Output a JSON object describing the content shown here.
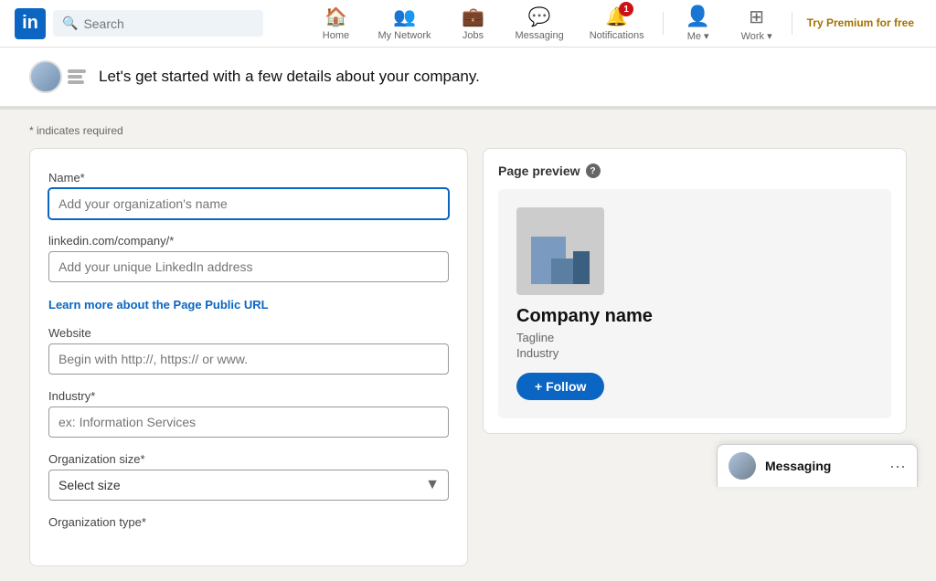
{
  "navbar": {
    "logo": "in",
    "search_placeholder": "Search",
    "nav_items": [
      {
        "id": "home",
        "label": "Home",
        "icon": "🏠",
        "badge": null
      },
      {
        "id": "my-network",
        "label": "My Network",
        "icon": "👥",
        "badge": null
      },
      {
        "id": "jobs",
        "label": "Jobs",
        "icon": "💼",
        "badge": null
      },
      {
        "id": "messaging",
        "label": "Messaging",
        "icon": "💬",
        "badge": null
      },
      {
        "id": "notifications",
        "label": "Notifications",
        "icon": "🔔",
        "badge": "1"
      },
      {
        "id": "me",
        "label": "Me ▾",
        "icon": "👤",
        "badge": null
      },
      {
        "id": "work",
        "label": "Work ▾",
        "icon": "⊞",
        "badge": null
      }
    ],
    "premium_label": "Try Premium for free"
  },
  "banner": {
    "text": "Let's get started with a few details about your company."
  },
  "form": {
    "required_note": "* indicates required",
    "name_label": "Name*",
    "name_placeholder": "Add your organization's name",
    "url_label": "linkedin.com/company/*",
    "url_placeholder": "Add your unique LinkedIn address",
    "learn_more_text": "Learn more about the Page Public URL",
    "website_label": "Website",
    "website_placeholder": "Begin with http://, https:// or www.",
    "industry_label": "Industry*",
    "industry_placeholder": "ex: Information Services",
    "org_size_label": "Organization size*",
    "org_size_placeholder": "Select size",
    "org_type_label": "Organization type*"
  },
  "preview": {
    "title": "Page preview",
    "company_name": "Company name",
    "tagline": "Tagline",
    "industry": "Industry",
    "follow_button": "+ Follow"
  },
  "messaging": {
    "label": "Messaging",
    "dots": "···"
  }
}
